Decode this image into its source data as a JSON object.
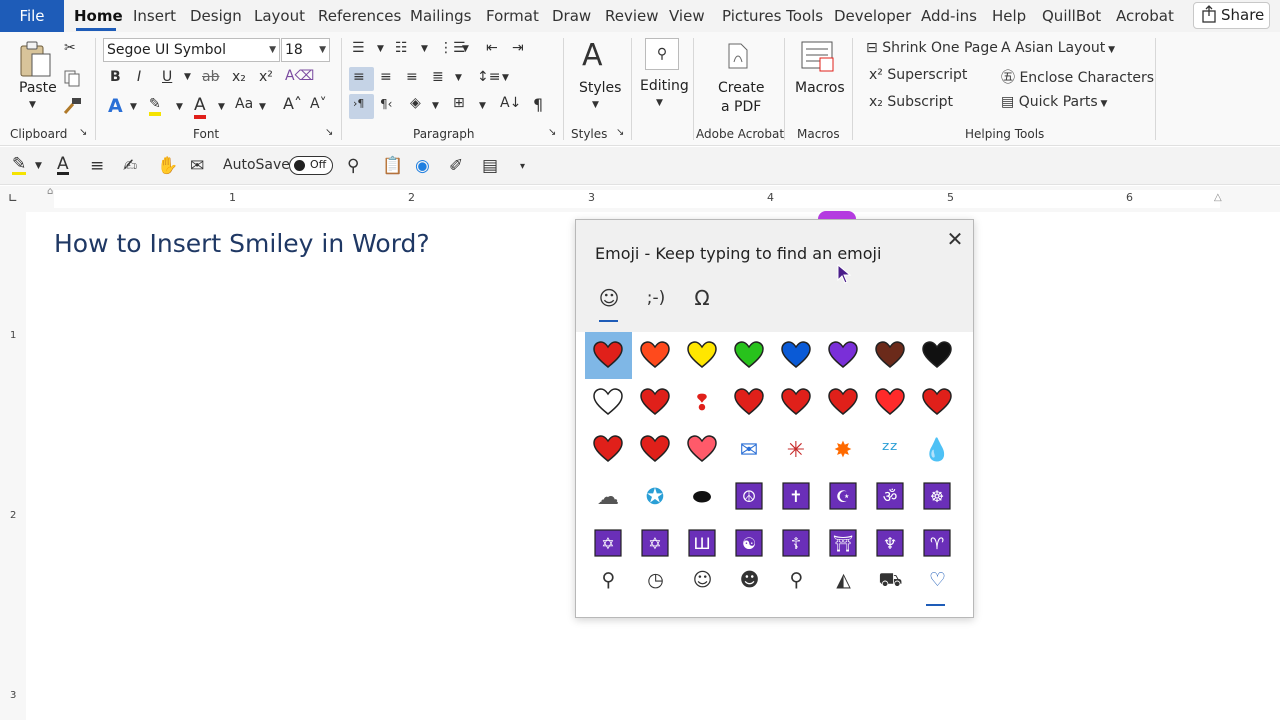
{
  "tabs": [
    "File",
    "Home",
    "Insert",
    "Design",
    "Layout",
    "References",
    "Mailings",
    "Format",
    "Draw",
    "Review",
    "View",
    "Pictures Tools",
    "Developer",
    "Add-ins",
    "Help",
    "QuillBot",
    "Acrobat"
  ],
  "share_label": "Share",
  "ribbon": {
    "clipboard": {
      "paste": "Paste",
      "group": "Clipboard"
    },
    "font": {
      "name": "Segoe UI Symbol",
      "size": "18",
      "group": "Font",
      "bold": "B",
      "italic": "I",
      "underline": "U",
      "strike": "ab",
      "subscript": "x₂",
      "superscript": "x²",
      "effects": "A",
      "highlight": "ab",
      "color": "A",
      "case": "Aa",
      "grow": "A˄",
      "shrink": "A˅"
    },
    "paragraph": {
      "group": "Paragraph"
    },
    "styles": {
      "label": "Styles",
      "group": "Styles"
    },
    "editing": {
      "label": "Editing"
    },
    "adobe": {
      "label_line1": "Create",
      "label_line2": "a PDF",
      "group": "Adobe Acrobat"
    },
    "macros": {
      "label": "Macros",
      "group": "Macros"
    },
    "helping": {
      "group": "Helping Tools",
      "shrink": "Shrink One Page",
      "superscript": "Superscript",
      "subscript": "Subscript",
      "asian": "Asian Layout",
      "enclose": "Enclose Characters",
      "quick_parts": "Quick Parts"
    }
  },
  "qat": {
    "autosave": "AutoSave",
    "toggle_state": "Off"
  },
  "ruler_numbers": [
    "1",
    "2",
    "3",
    "4",
    "5",
    "6"
  ],
  "vruler_numbers": [
    "1",
    "2",
    "3"
  ],
  "document": {
    "heading": "How to Insert Smiley in Word?"
  },
  "emoji_panel": {
    "title": "Emoji - Keep typing to find an emoji",
    "tabs": [
      "☺",
      ";-)",
      "Ω"
    ],
    "rows": [
      [
        "red heart",
        "orange heart",
        "yellow heart",
        "green heart",
        "blue heart",
        "purple heart",
        "brown heart",
        "black heart"
      ],
      [
        "white heart",
        "broken heart",
        "heart exclamation",
        "two hearts",
        "revolving hearts",
        "beating heart",
        "growing heart",
        "sparkling heart"
      ],
      [
        "heart with arrow",
        "heart with ribbon",
        "heart decoration",
        "love letter",
        "anger symbol",
        "collision",
        "zzz",
        "sweat droplets"
      ],
      [
        "dashing away",
        "dizzy",
        "hole",
        "peace symbol",
        "latin cross",
        "star and crescent",
        "om",
        "wheel of dharma"
      ],
      [
        "star of david",
        "dotted six-pointed star",
        "menorah",
        "yin yang",
        "orthodox cross",
        "place of worship",
        "trident",
        "aries"
      ]
    ],
    "selected_index": 0,
    "categories": [
      "search-icon",
      "recent-icon",
      "smiley-icon",
      "people-icon",
      "celebration-icon",
      "food-icon",
      "transport-icon",
      "heart-icon"
    ],
    "colors": {
      "accent": "#1e5cb8",
      "selection": "#7fb7e6",
      "heart_red": "#e0201a",
      "purple_tile": "#6a2fb8"
    }
  }
}
